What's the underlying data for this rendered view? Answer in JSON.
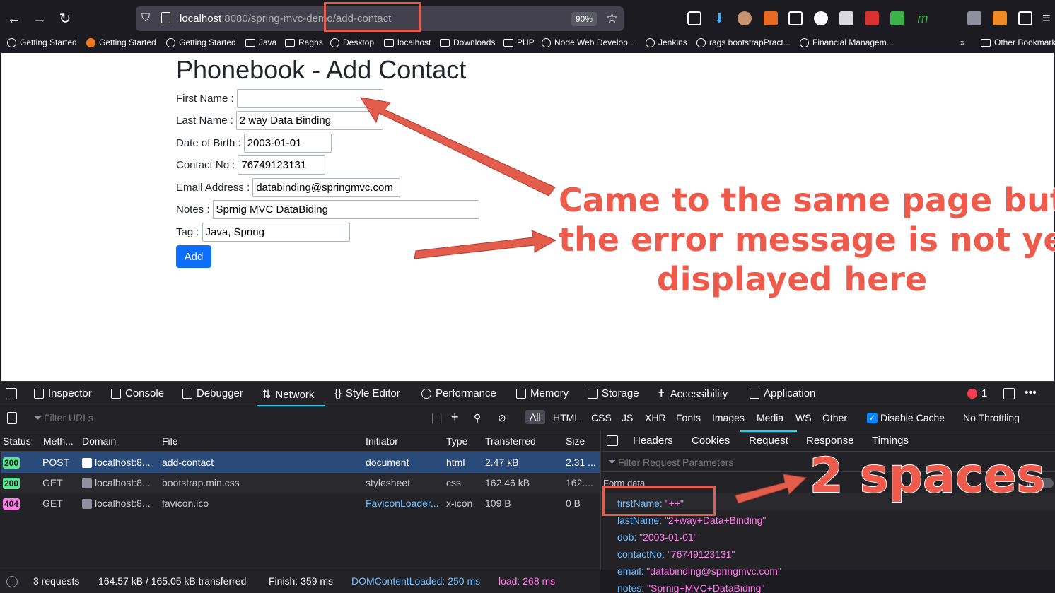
{
  "browser": {
    "url_host": "localhost",
    "url_path": ":8080/spring-mvc-demo/add-contact",
    "zoom": "90%",
    "bookmarks": [
      "Getting Started",
      "Getting Started",
      "Getting Started",
      "Java",
      "Raghs",
      "Desktop",
      "localhost",
      "Downloads",
      "PHP",
      "Node Web Develop...",
      "Jenkins",
      "rags bootstrapPract...",
      "Financial Managem..."
    ],
    "other_bookmarks": "Other Bookmarks"
  },
  "page": {
    "title": "Phonebook - Add Contact",
    "fields": [
      {
        "label": "First Name :",
        "value": ""
      },
      {
        "label": "Last Name :",
        "value": "2 way Data Binding"
      },
      {
        "label": "Date of Birth :",
        "value": "2003-01-01"
      },
      {
        "label": "Contact No :",
        "value": "76749123131"
      },
      {
        "label": "Email Address :",
        "value": "databinding@springmvc.com"
      },
      {
        "label": "Notes :",
        "value": "Sprnig MVC DataBiding"
      },
      {
        "label": "Tag :",
        "value": "Java, Spring"
      }
    ],
    "add_button": "Add"
  },
  "devtools": {
    "tabs": [
      "Inspector",
      "Console",
      "Debugger",
      "Network",
      "Style Editor",
      "Performance",
      "Memory",
      "Storage",
      "Accessibility",
      "Application"
    ],
    "error_count": "1",
    "filter_placeholder": "Filter URLs",
    "type_filters": [
      "All",
      "HTML",
      "CSS",
      "JS",
      "XHR",
      "Fonts",
      "Images",
      "Media",
      "WS",
      "Other"
    ],
    "disable_cache": "Disable Cache",
    "throttling": "No Throttling",
    "columns": [
      "Status",
      "Meth...",
      "Domain",
      "File",
      "Initiator",
      "Type",
      "Transferred",
      "Size"
    ],
    "requests": [
      {
        "status": "200",
        "method": "POST",
        "domain": "localhost:8...",
        "file": "add-contact",
        "initiator": "document",
        "type": "html",
        "transferred": "2.47 kB",
        "size": "2.31 ..."
      },
      {
        "status": "200",
        "method": "GET",
        "domain": "localhost:8...",
        "file": "bootstrap.min.css",
        "initiator": "stylesheet",
        "type": "css",
        "transferred": "162.46 kB",
        "size": "162...."
      },
      {
        "status": "404",
        "method": "GET",
        "domain": "localhost:8...",
        "file": "favicon.ico",
        "initiator": "FaviconLoader...",
        "type": "x-icon",
        "transferred": "109 B",
        "size": "0 B"
      }
    ],
    "pane_tabs": [
      "Headers",
      "Cookies",
      "Request",
      "Response",
      "Timings"
    ],
    "param_filter": "Filter Request Parameters",
    "form_data_label": "Form data",
    "form_data": [
      {
        "key": "firstName:",
        "value": "\"++\""
      },
      {
        "key": "lastName:",
        "value": "\"2+way+Data+Binding\""
      },
      {
        "key": "dob:",
        "value": "\"2003-01-01\""
      },
      {
        "key": "contactNo:",
        "value": "\"76749123131\""
      },
      {
        "key": "email:",
        "value": "\"databinding@springmvc.com\""
      },
      {
        "key": "notes:",
        "value": "\"Sprnig+MVC+DataBiding\""
      }
    ],
    "status": {
      "requests": "3 requests",
      "size": "164.57 kB / 165.05 kB transferred",
      "finish": "Finish: 359 ms",
      "dcl": "DOMContentLoaded: 250 ms",
      "load": "load: 268 ms"
    }
  },
  "annotations": {
    "main_line1": "Came to the same page but",
    "main_line2": "the error message is not yet",
    "main_line3": "displayed here",
    "spaces": "2 spaces"
  },
  "colors": {
    "accent": "#0d6efd",
    "annotation": "#ee5a4b",
    "selected_row": "#2a4a7a",
    "key": "#75bfff",
    "value": "#ff7de9"
  }
}
